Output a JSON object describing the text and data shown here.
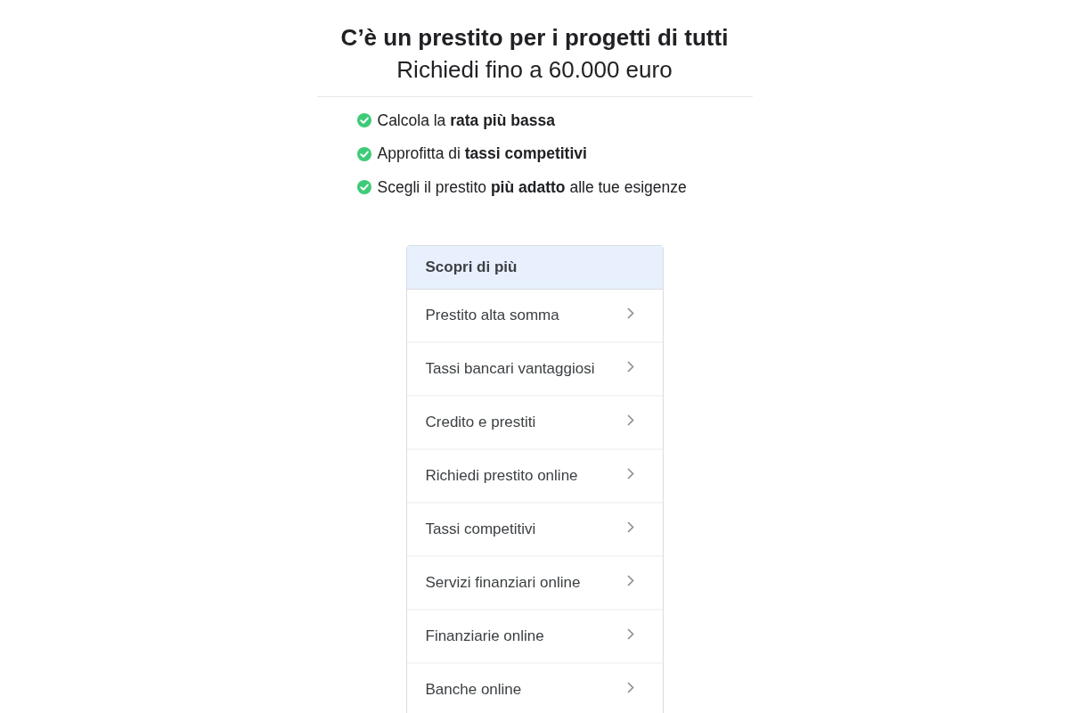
{
  "header": {
    "title": "C’è un prestito per i progetti di tutti",
    "subtitle": "Richiedi fino a 60.000 euro"
  },
  "benefits": [
    "Calcola la **rata più bassa**",
    "Approfitta di **tassi competitivi**",
    "Scegli il prestito **più adatto** alle tue esigenze"
  ],
  "more_panel": {
    "title": "Scopri di più",
    "links": [
      "Prestito alta somma",
      "Tassi bancari vantaggiosi",
      "Credito e prestiti",
      "Richiedi prestito online",
      "Tassi competitivi",
      "Servizi finanziari online",
      "Finanziarie online",
      "Banche online"
    ]
  }
}
